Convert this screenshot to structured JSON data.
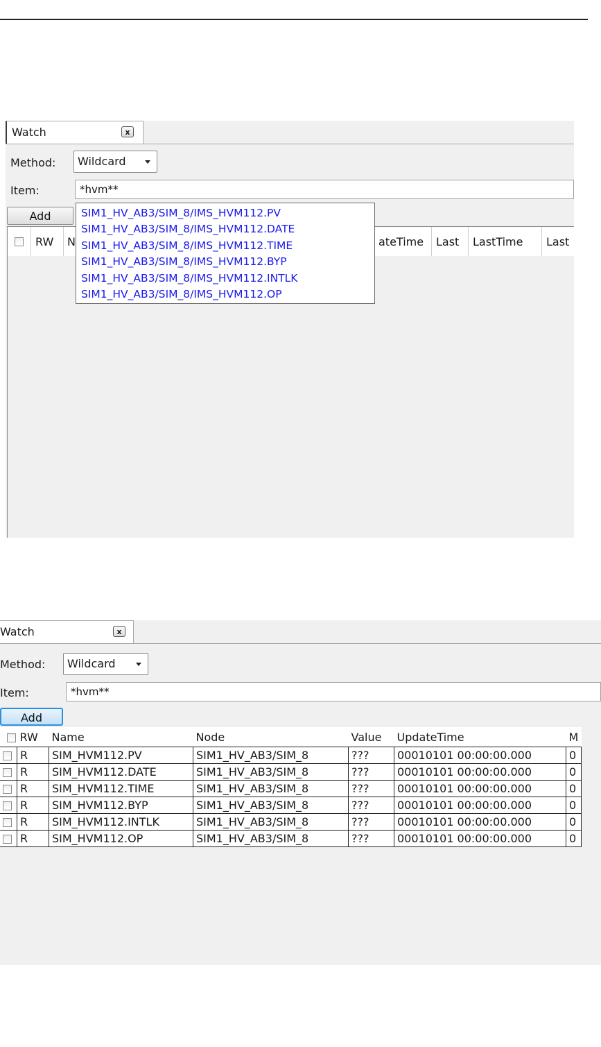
{
  "panel_before": {
    "tab": {
      "title": "Watch",
      "close_glyph": "x"
    },
    "method": {
      "label": "Method:",
      "selected": "Wildcard"
    },
    "item": {
      "label": "Item:",
      "value": "*hvm**"
    },
    "add_label": "Add",
    "columns_visible": [
      "RW",
      "N",
      "ateTime",
      "Last",
      "LastTime",
      "Last"
    ],
    "suggestions": [
      "SIM1_HV_AB3/SIM_8/IMS_HVM112.PV",
      "SIM1_HV_AB3/SIM_8/IMS_HVM112.DATE",
      "SIM1_HV_AB3/SIM_8/IMS_HVM112.TIME",
      "SIM1_HV_AB3/SIM_8/IMS_HVM112.BYP",
      "SIM1_HV_AB3/SIM_8/IMS_HVM112.INTLK",
      "SIM1_HV_AB3/SIM_8/IMS_HVM112.OP"
    ],
    "suggestion_color": "#1a1aee"
  },
  "panel_after": {
    "tab": {
      "title": "Watch",
      "close_glyph": "x"
    },
    "method": {
      "label": "Method:",
      "selected": "Wildcard"
    },
    "item": {
      "label": "Item:",
      "value": "*hvm**"
    },
    "add_label": "Add",
    "columns": [
      "RW",
      "Name",
      "Node",
      "Value",
      "UpdateTime",
      "M"
    ],
    "rows": [
      {
        "rw": "R",
        "name": "SIM_HVM112.PV",
        "node": "SIM1_HV_AB3/SIM_8",
        "value": "???",
        "update": "00010101 00:00:00.000",
        "m": "0"
      },
      {
        "rw": "R",
        "name": "SIM_HVM112.DATE",
        "node": "SIM1_HV_AB3/SIM_8",
        "value": "???",
        "update": "00010101 00:00:00.000",
        "m": "0"
      },
      {
        "rw": "R",
        "name": "SIM_HVM112.TIME",
        "node": "SIM1_HV_AB3/SIM_8",
        "value": "???",
        "update": "00010101 00:00:00.000",
        "m": "0"
      },
      {
        "rw": "R",
        "name": "SIM_HVM112.BYP",
        "node": "SIM1_HV_AB3/SIM_8",
        "value": "???",
        "update": "00010101 00:00:00.000",
        "m": "0"
      },
      {
        "rw": "R",
        "name": "SIM_HVM112.INTLK",
        "node": "SIM1_HV_AB3/SIM_8",
        "value": "???",
        "update": "00010101 00:00:00.000",
        "m": "0"
      },
      {
        "rw": "R",
        "name": "SIM_HVM112.OP",
        "node": "SIM1_HV_AB3/SIM_8",
        "value": "???",
        "update": "00010101 00:00:00.000",
        "m": "0"
      }
    ],
    "add_button_accent": "#2f8fd8"
  }
}
